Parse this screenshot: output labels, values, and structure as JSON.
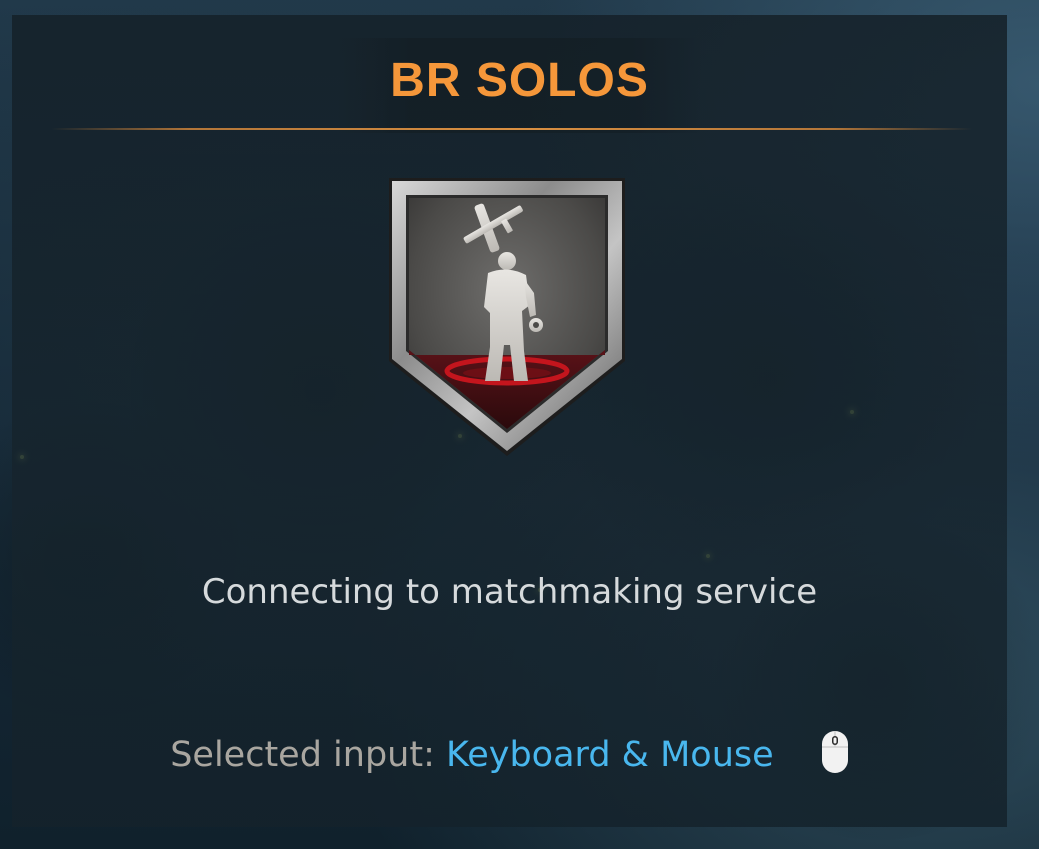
{
  "mode": {
    "title": "BR SOLOS"
  },
  "status": {
    "message": "Connecting to matchmaking service"
  },
  "input": {
    "label": "Selected input:",
    "value": "Keyboard & Mouse",
    "icon": "mouse-icon"
  },
  "emblem": {
    "icon": "victory-soldier-emblem-icon"
  },
  "colors": {
    "title": "#f5973a",
    "accent_line": "#c47f3a",
    "status_text": "#d6dadc",
    "input_label": "#a9a6a0",
    "input_value": "#49b7ee"
  }
}
